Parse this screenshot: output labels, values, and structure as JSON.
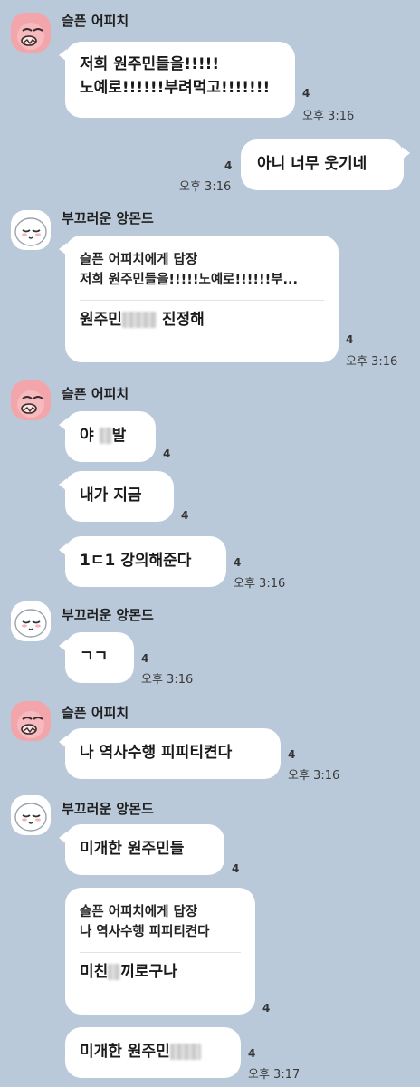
{
  "senders": {
    "peach": "슬픈 어피치",
    "almond": "부끄러운 앙몬드"
  },
  "messages": {
    "m1_line1": "저희 원주민들을!!!!!",
    "m1_line2": "노예로!!!!!!부려먹고!!!!!!!",
    "m1_count": "4",
    "m1_time": "오후 3:16",
    "m2_text": "아니 너무 웃기네",
    "m2_count": "4",
    "m2_time": "오후 3:16",
    "m3_reply_head": "슬픈 어피치에게 답장",
    "m3_reply_quote": "저희 원주민들을!!!!!노예로!!!!!!부...",
    "m3_text_a": "원주민",
    "m3_text_b": "진정해",
    "m3_count": "4",
    "m3_time": "오후 3:16",
    "m4_text_a": "야",
    "m4_text_b": "발",
    "m4_count": "4",
    "m5_text": "내가 지금",
    "m5_count": "4",
    "m6_text": "1ㄷ1 강의해준다",
    "m6_count": "4",
    "m6_time": "오후 3:16",
    "m7_text": "ㄱㄱ",
    "m7_count": "4",
    "m7_time": "오후 3:16",
    "m8_text": "나 역사수행 피피티켠다",
    "m8_count": "4",
    "m8_time": "오후 3:16",
    "m9_text": "미개한 원주민들",
    "m9_count": "4",
    "m10_reply_head": "슬픈 어피치에게 답장",
    "m10_reply_quote": "나 역사수행 피피티켠다",
    "m10_text_a": "미친",
    "m10_text_b": "끼로구나",
    "m10_count": "4",
    "m11_text": "미개한 원주민",
    "m11_count": "4",
    "m11_time": "오후 3:17"
  },
  "colors": {
    "background": "#bac9d9",
    "bubble": "#ffffff",
    "peach_avatar": "#f2a0a6",
    "almond_avatar": "#ffffff"
  }
}
